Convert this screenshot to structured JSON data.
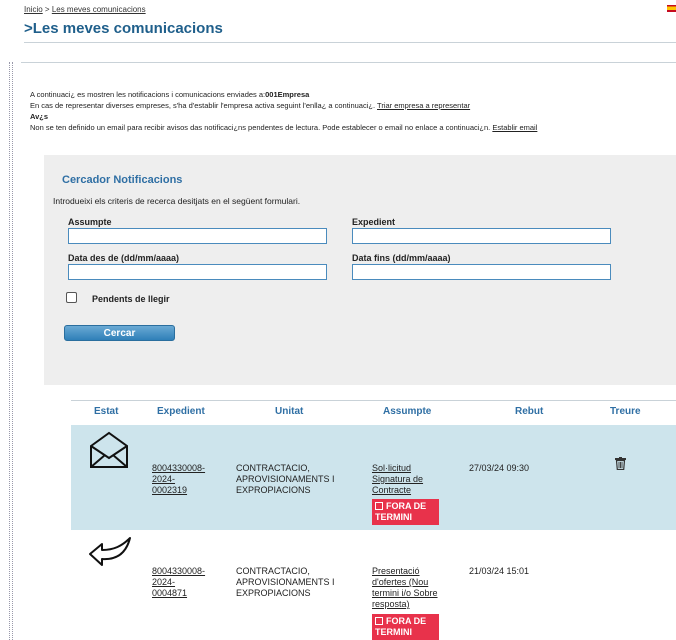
{
  "breadcrumb": {
    "home": "Inicio",
    "separator": " > ",
    "current": "Les meves comunicacions"
  },
  "page_title": ">Les meves comunicacions",
  "info": {
    "line1_prefix": "A continuaci¿ es mostren les notificacions i comunicacions enviades a:",
    "line1_company": "001Empresa",
    "line2_prefix": "En cas de representar diverses empreses, s'ha d'establir l'empresa activa seguint l'enlla¿ a continuaci¿. ",
    "line2_link": "Triar empresa a representar",
    "line3": "Av¿s",
    "line4_prefix": "Non se ten definido un email para recibir avisos das notificaci¿ns pendentes de lectura. Pode establecer o email no enlace a continuaci¿n. ",
    "line4_link": "Establir email"
  },
  "search": {
    "title": "Cercador Notificacions",
    "intro": "Introdueixi els criteris de recerca desitjats en el següent formulari.",
    "assumpte_label": "Assumpte",
    "assumpte_value": "",
    "expedient_label": "Expedient",
    "expedient_value": "",
    "date_from_label": "Data des de (dd/mm/aaaa)",
    "date_from_value": "",
    "date_to_label": "Data fins (dd/mm/aaaa)",
    "date_to_value": "",
    "pending_label": "Pendents de llegir",
    "pending_checked": false,
    "button_label": "Cercar"
  },
  "table": {
    "headers": [
      "Estat",
      "Expedient",
      "Unitat",
      "Assumpte",
      "Rebut",
      "Treure"
    ],
    "rows": [
      {
        "status_icon": "envelope-open-icon",
        "expedient": [
          "8004330008-",
          "2024-",
          "0002319"
        ],
        "unitat": [
          "CONTRACTACIO,",
          "APROVISIONAMENTS I",
          "EXPROPIACIONS"
        ],
        "assumpte": [
          "Sol·licitud",
          "Signatura de",
          "Contracte"
        ],
        "badge": [
          "FORA DE",
          "TERMINI"
        ],
        "rebut": "27/03/24 09:30",
        "remove_icon": "trash-icon"
      },
      {
        "status_icon": "reply-arrow-icon",
        "expedient": [
          "8004330008-",
          "2024-",
          "0004871"
        ],
        "unitat": [
          "CONTRACTACIO,",
          "APROVISIONAMENTS I",
          "EXPROPIACIONS"
        ],
        "assumpte": [
          "Presentació",
          "d'ofertes (Nou",
          "termini i/o Sobre",
          "resposta)"
        ],
        "badge": [
          "FORA DE",
          "TERMINI"
        ],
        "rebut": "21/03/24 15:01",
        "remove_icon": ""
      }
    ]
  },
  "colors": {
    "accent": "#2f6fa4",
    "row_highlight": "#cde4ec",
    "badge": "#e8324b",
    "panel": "#eeeeee"
  }
}
